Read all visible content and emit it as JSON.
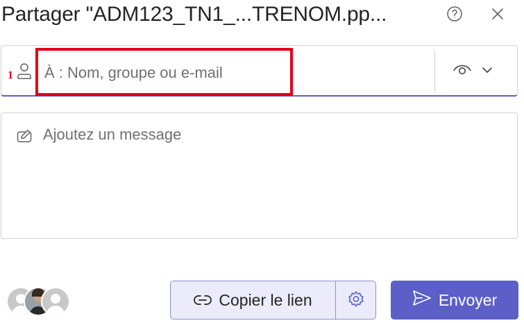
{
  "dialog": {
    "title": "Partager \"ADM123_TN1_...TRENOM.pp...",
    "help_icon": "question-circle-icon",
    "close_icon": "close-icon"
  },
  "recipients": {
    "icon": "person-icon",
    "placeholder": "À : Nom, groupe ou e-mail",
    "value": "",
    "permission_icon": "eye-icon",
    "permission_dropdown_icon": "chevron-down-icon"
  },
  "annotation": {
    "number": "1",
    "color": "#e2001a"
  },
  "message": {
    "icon": "edit-icon",
    "placeholder": "Ajoutez un message",
    "value": ""
  },
  "footer": {
    "avatars": [
      "avatar-person-placeholder",
      "avatar-photo",
      "avatar-person-placeholder"
    ],
    "copy_link_label": "Copier le lien",
    "copy_link_icon": "link-icon",
    "settings_icon": "gear-icon",
    "send_label": "Envoyer",
    "send_icon": "send-icon"
  },
  "colors": {
    "accent": "#5b5fc7",
    "copy_bg": "#ebebf9",
    "border": "#d1d1d1"
  }
}
